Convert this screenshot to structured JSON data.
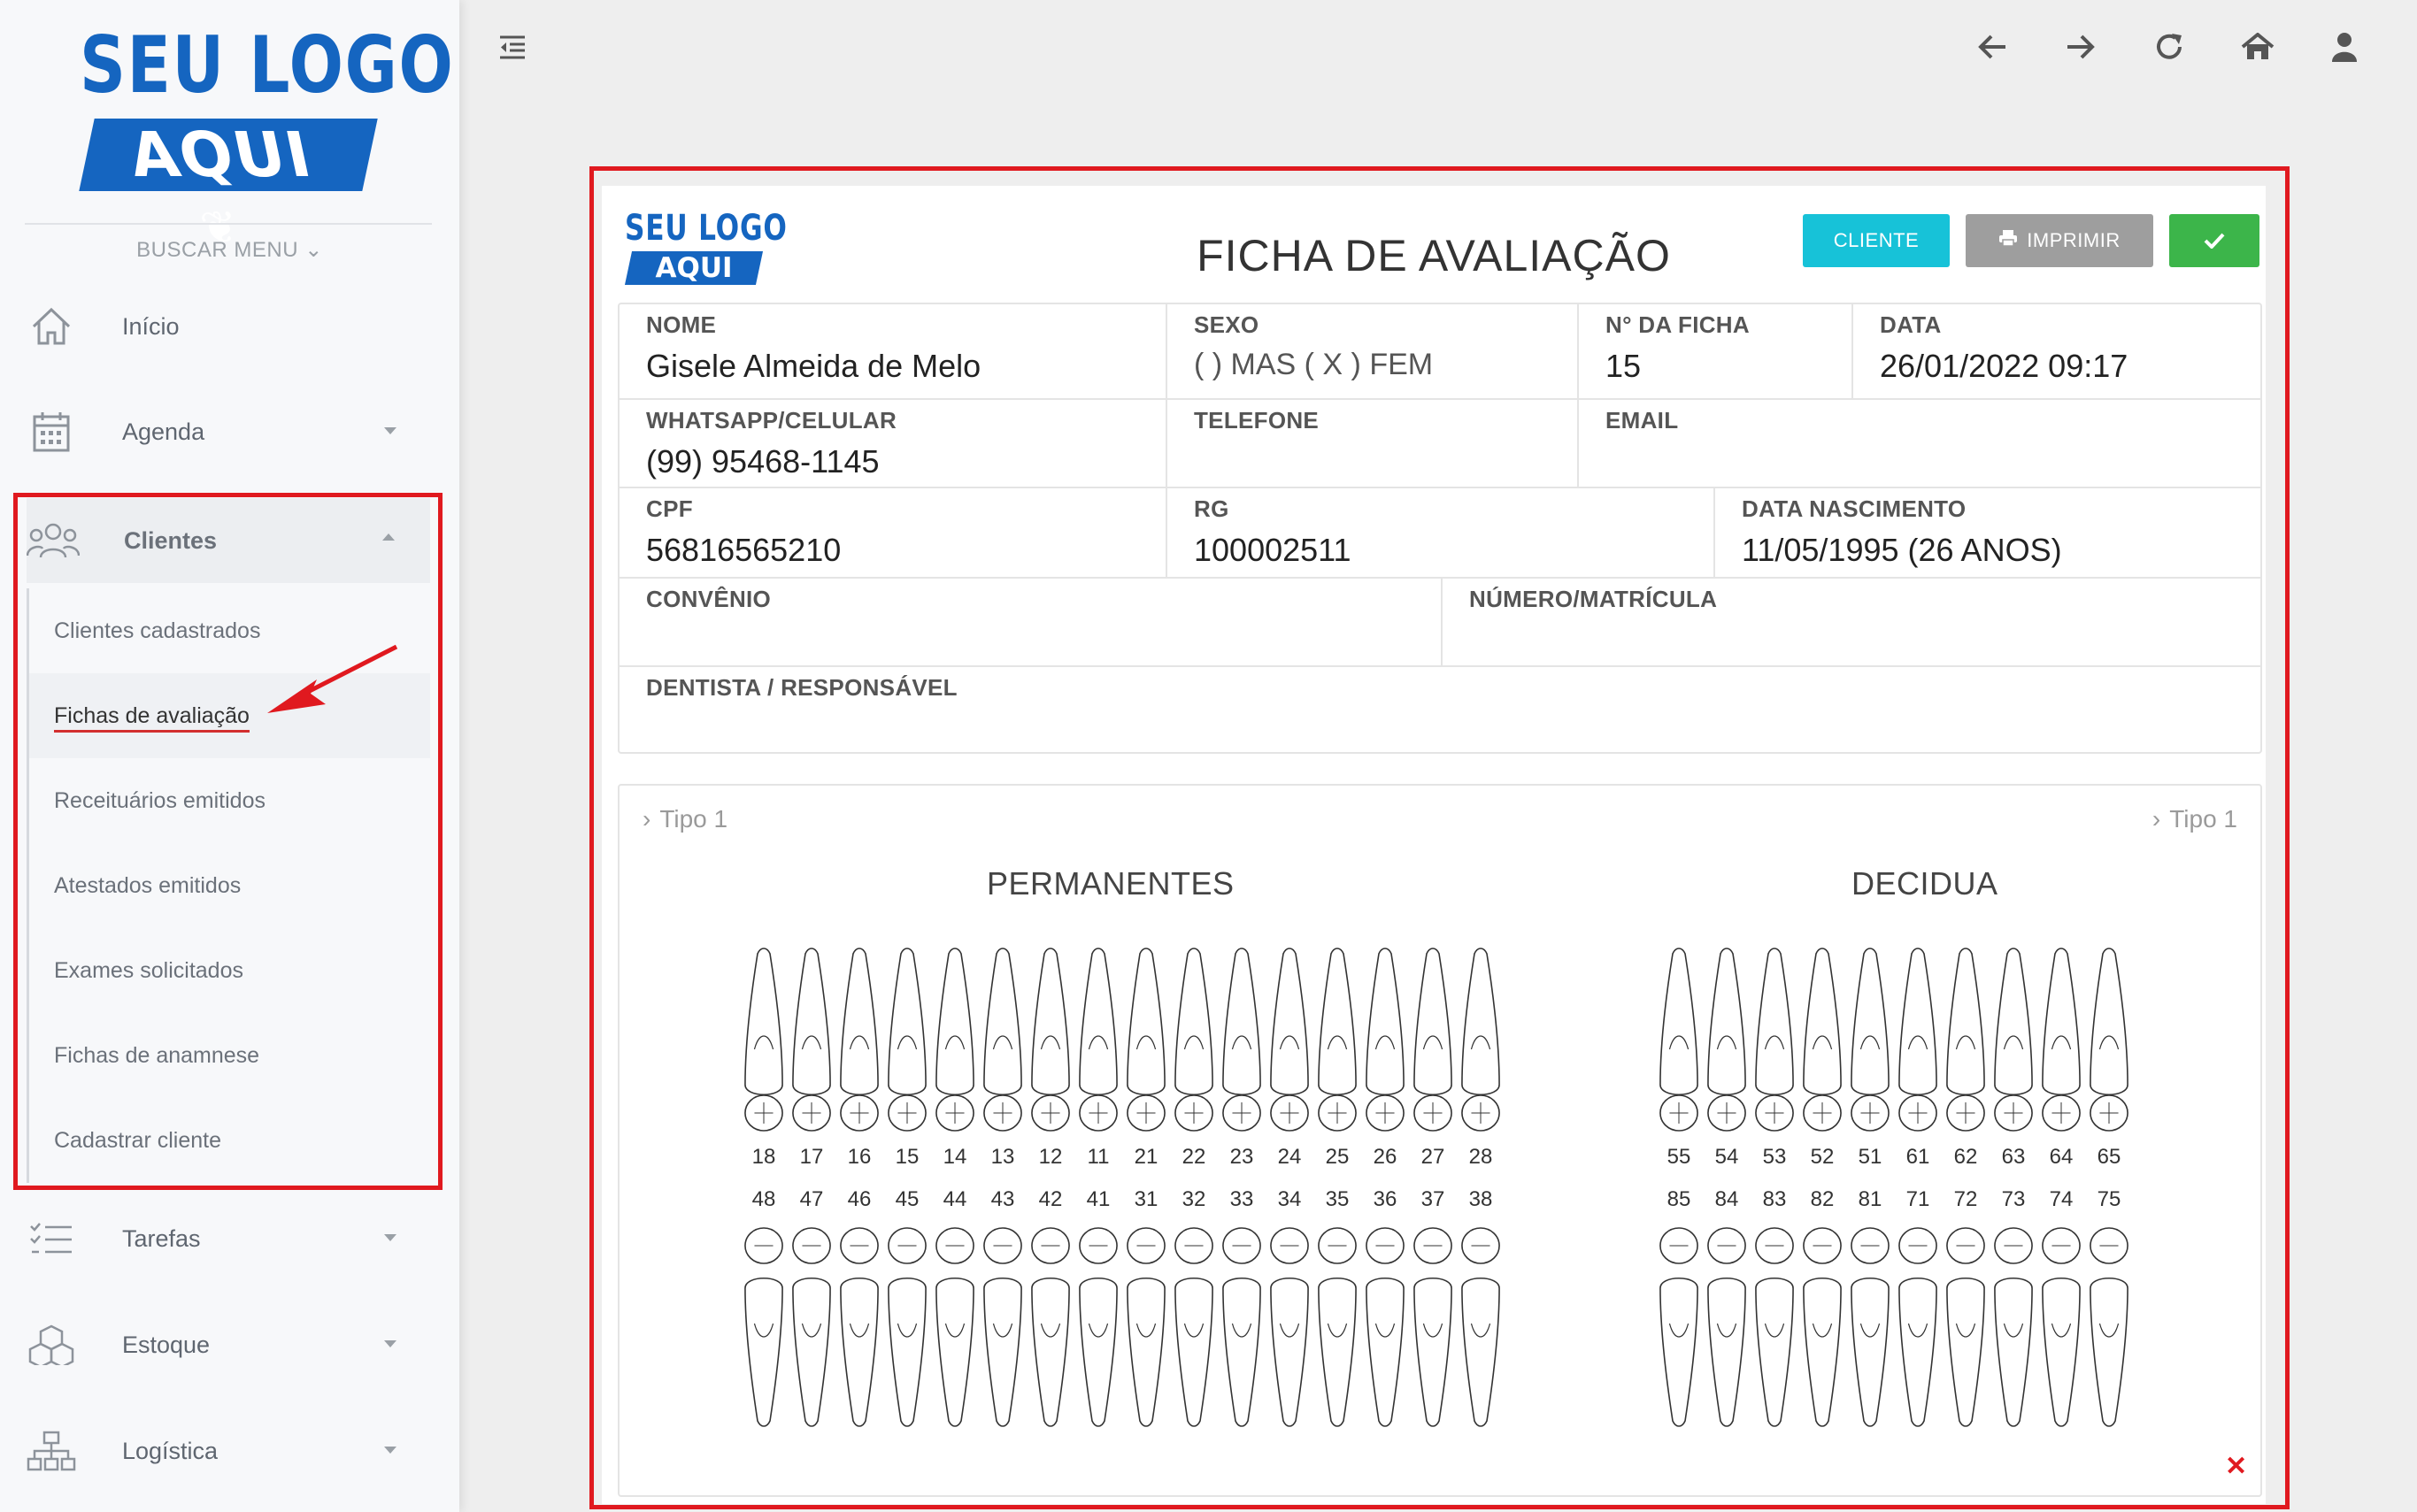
{
  "colors": {
    "brand_blue": "#1565c0",
    "highlight_red": "#e0191f",
    "cliente_btn": "#17c2d8",
    "imprimir_btn": "#9e9e9e",
    "ok_btn": "#3cb54a"
  },
  "sidebar": {
    "logo_top": "SEU LOGO",
    "logo_bottom": "AQUI",
    "buscar_menu": "BUSCAR MENU",
    "items": [
      {
        "label": "Início",
        "icon": "home-icon"
      },
      {
        "label": "Agenda",
        "icon": "calendar-icon"
      },
      {
        "label": "Clientes",
        "icon": "users-icon"
      },
      {
        "label": "Tarefas",
        "icon": "tasks-icon"
      },
      {
        "label": "Estoque",
        "icon": "boxes-icon"
      },
      {
        "label": "Logística",
        "icon": "sitemap-icon"
      }
    ],
    "submenu": [
      "Clientes cadastrados",
      "Fichas de avaliação",
      "Receituários emitidos",
      "Atestados emitidos",
      "Exames solicitados",
      "Fichas de anamnese",
      "Cadastrar cliente"
    ]
  },
  "topbar": {
    "icons": [
      "menu-collapse-icon",
      "back-arrow-icon",
      "forward-arrow-icon",
      "refresh-icon",
      "home-icon",
      "user-icon"
    ]
  },
  "card": {
    "logo_top": "SEU LOGO",
    "logo_bottom": "AQUI",
    "title": "FICHA DE AVALIAÇÃO",
    "buttons": {
      "cliente": "CLIENTE",
      "imprimir": "IMPRIMIR"
    },
    "fields": {
      "nome_label": "NOME",
      "nome_value": "Gisele Almeida de Melo",
      "sexo_label": "SEXO",
      "sexo_value": "(   ) MAS ( X ) FEM",
      "ficha_label": "N° DA FICHA",
      "ficha_value": "15",
      "data_label": "DATA",
      "data_value": "26/01/2022 09:17",
      "whatsapp_label": "WHATSAPP/CELULAR",
      "whatsapp_value": "(99) 95468-1145",
      "telefone_label": "TELEFONE",
      "telefone_value": "",
      "email_label": "EMAIL",
      "email_value": "",
      "cpf_label": "CPF",
      "cpf_value": "56816565210",
      "rg_label": "RG",
      "rg_value": "100002511",
      "nascimento_label": "DATA NASCIMENTO",
      "nascimento_value": "11/05/1995 (26 ANOS)",
      "convenio_label": "CONVÊNIO",
      "convenio_value": "",
      "matricula_label": "NÚMERO/MATRÍCULA",
      "matricula_value": "",
      "dentista_label": "DENTISTA / RESPONSÁVEL",
      "dentista_value": ""
    },
    "odontogram": {
      "tipo_left": "Tipo 1",
      "tipo_right": "Tipo 1",
      "permanentes_title": "PERMANENTES",
      "decidua_title": "DECIDUA",
      "perm_upper": [
        "18",
        "17",
        "16",
        "15",
        "14",
        "13",
        "12",
        "11",
        "21",
        "22",
        "23",
        "24",
        "25",
        "26",
        "27",
        "28"
      ],
      "perm_lower": [
        "48",
        "47",
        "46",
        "45",
        "44",
        "43",
        "42",
        "41",
        "31",
        "32",
        "33",
        "34",
        "35",
        "36",
        "37",
        "38"
      ],
      "dec_upper": [
        "55",
        "54",
        "53",
        "52",
        "51",
        "61",
        "62",
        "63",
        "64",
        "65"
      ],
      "dec_lower": [
        "85",
        "84",
        "83",
        "82",
        "81",
        "71",
        "72",
        "73",
        "74",
        "75"
      ]
    }
  }
}
